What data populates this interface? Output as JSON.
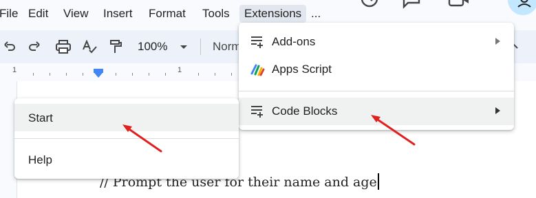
{
  "menubar": {
    "items": [
      "File",
      "Edit",
      "View",
      "Insert",
      "Format",
      "Tools",
      "Extensions"
    ],
    "overflow": "..."
  },
  "toolbar": {
    "zoom": "100%",
    "style": "Norm"
  },
  "ruler": {
    "marks": [
      "1",
      "1"
    ]
  },
  "extensions_menu": {
    "items": [
      {
        "label": "Add-ons",
        "icon": "add-ons-icon",
        "has_submenu": true
      },
      {
        "label": "Apps Script",
        "icon": "apps-script-icon",
        "has_submenu": false
      },
      {
        "label": "Code Blocks",
        "icon": "code-blocks-icon",
        "has_submenu": true
      }
    ]
  },
  "code_blocks_submenu": {
    "items": [
      {
        "label": "Start"
      },
      {
        "label": "Help"
      }
    ]
  },
  "document": {
    "line": "// Prompt the user for their name and age"
  },
  "colors": {
    "accent": "#4285f4",
    "annotation_arrow": "#e02020"
  }
}
